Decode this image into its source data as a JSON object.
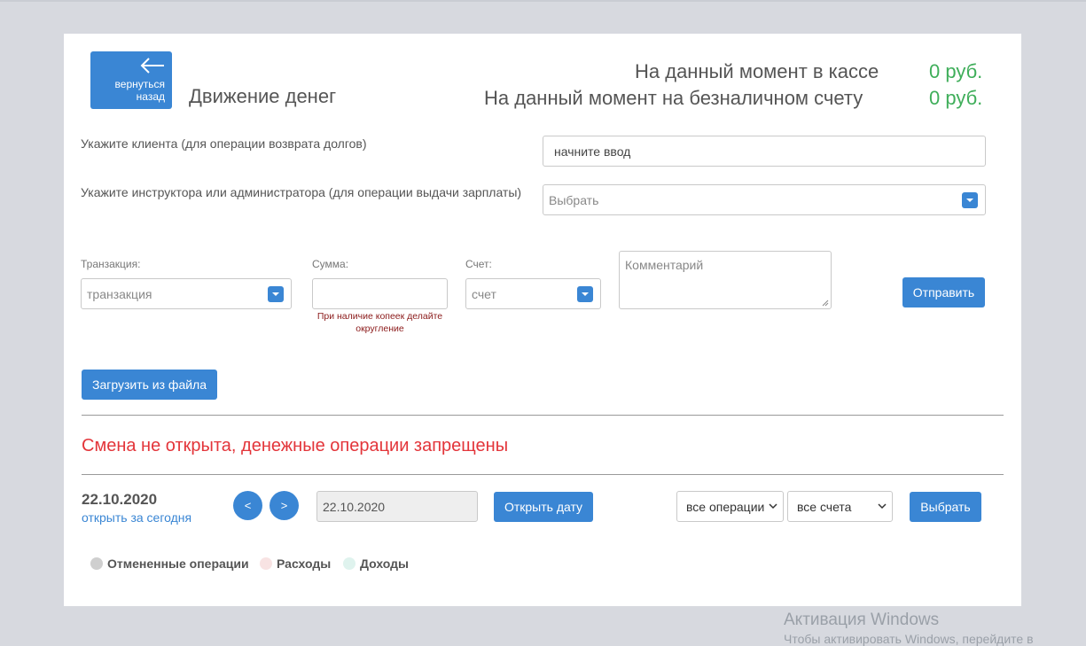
{
  "header": {
    "back_label": "вернуться назад",
    "title": "Движение денег",
    "cash_label": "На данный момент в кассе",
    "cash_value": "0 руб.",
    "cashless_label": "На данный момент на безналичном счету",
    "cashless_value": "0 руб."
  },
  "client": {
    "label": "Укажите клиента (для операции возврата долгов)",
    "value": "начните ввод"
  },
  "instructor": {
    "label": "Укажите инструктора или администратора (для операции выдачи зарплаты)",
    "value": "Выбрать"
  },
  "transaction": {
    "label": "Транзакция:",
    "value": "транзакция"
  },
  "amount": {
    "label": "Сумма:",
    "value": "",
    "hint": "При наличие копеек делайте округление"
  },
  "account": {
    "label": "Счет:",
    "value": "счет"
  },
  "comment": {
    "placeholder": "Комментарий"
  },
  "buttons": {
    "submit": "Отправить",
    "upload": "Загрузить из файла",
    "open_date": "Открыть дату",
    "choose": "Выбрать",
    "prev": "<",
    "next": ">"
  },
  "shift_warning": "Смена не открыта, денежные операции запрещены",
  "date": {
    "current": "22.10.2020",
    "open_today": "открыть за сегодня",
    "input_value": "22.10.2020"
  },
  "filters": {
    "operations": "все операции",
    "accounts": "все счета"
  },
  "legend": [
    {
      "label": "Отмененные операции",
      "color": "#cfcfcf"
    },
    {
      "label": "Расходы",
      "color": "#f8e3e3"
    },
    {
      "label": "Доходы",
      "color": "#dff3ee"
    }
  ],
  "watermark": {
    "title": "Активация Windows",
    "subtitle": "Чтобы активировать Windows, перейдите в"
  },
  "colors": {
    "accent": "#3a86d4",
    "positive": "#3fae5a",
    "warning": "#e3353a"
  },
  "icons": {
    "back": "arrow-left-icon",
    "dropdown": "chevron-down-icon"
  }
}
